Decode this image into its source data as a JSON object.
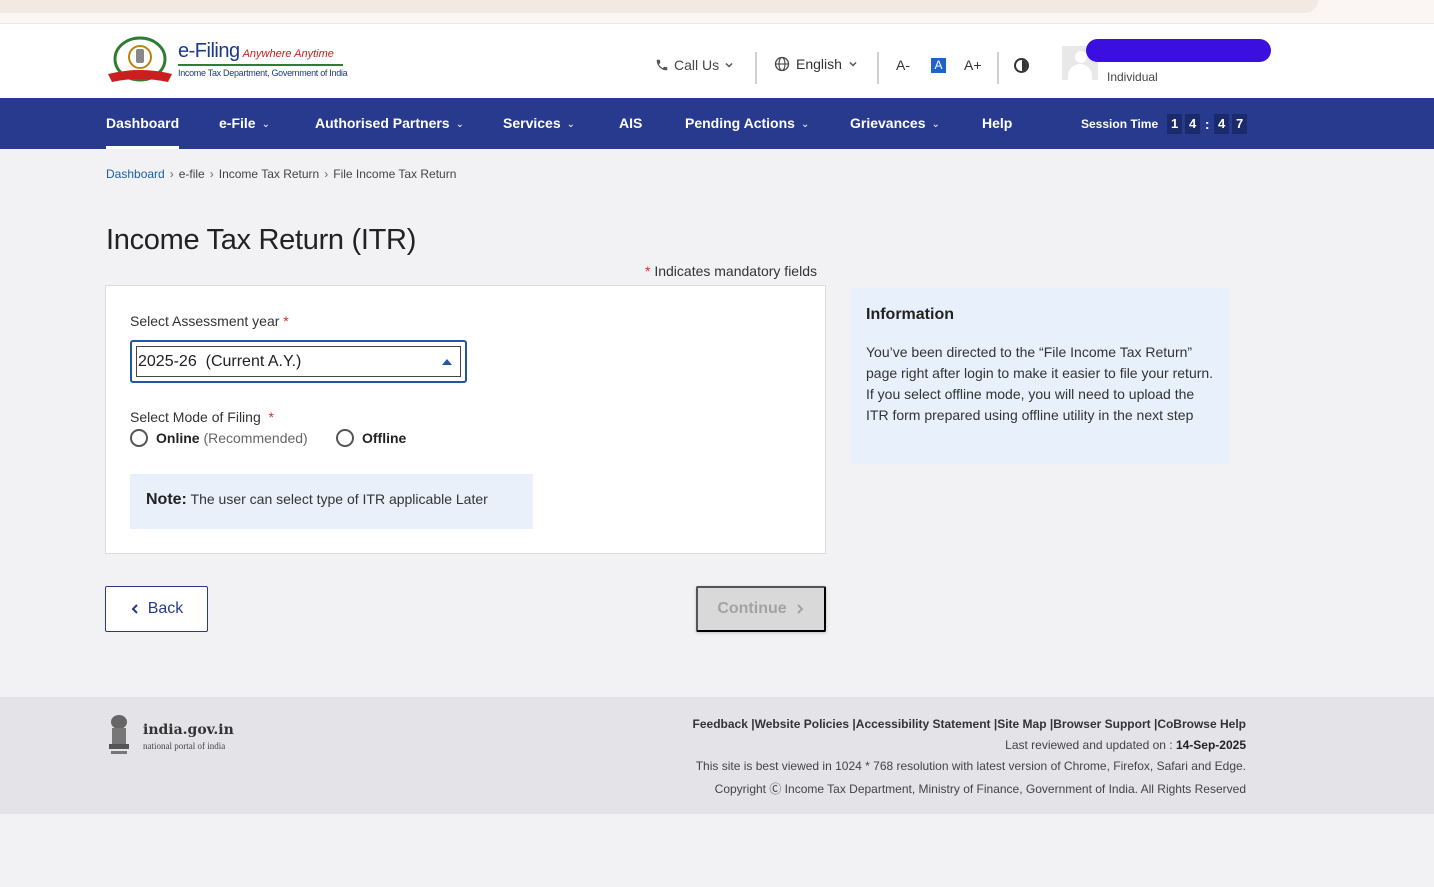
{
  "header": {
    "brand": "e-Filing",
    "tagline": "Anywhere Anytime",
    "subtitle": "Income Tax Department, Government of India",
    "call_us": "Call Us",
    "language": "English",
    "font_decrease": "A-",
    "font_normal": "A",
    "font_increase": "A+",
    "user_role": "Individual"
  },
  "nav": {
    "items": [
      {
        "label": "Dashboard"
      },
      {
        "label": "e-File"
      },
      {
        "label": "Authorised Partners"
      },
      {
        "label": "Services"
      },
      {
        "label": "AIS"
      },
      {
        "label": "Pending Actions"
      },
      {
        "label": "Grievances"
      },
      {
        "label": "Help"
      }
    ],
    "session_label": "Session Time",
    "session_digits": [
      "1",
      "4",
      ":",
      "4",
      "7"
    ]
  },
  "breadcrumb": [
    "Dashboard",
    "e-file",
    "Income Tax Return",
    "File Income Tax Return"
  ],
  "page": {
    "title": "Income Tax Return (ITR)",
    "mandatory_note": "Indicates mandatory fields",
    "star": "*"
  },
  "form": {
    "assessment_year_label": "Select Assessment year",
    "assessment_year_value": "2025-26  (Current A.Y.)",
    "mode_label": "Select Mode of Filing",
    "online_label": "Online",
    "online_hint": "(Recommended)",
    "offline_label": "Offline",
    "note_label": "Note:",
    "note_text": "The user can select type of ITR applicable Later"
  },
  "info": {
    "title": "Information",
    "text": "You’ve been directed to the “File Income Tax Return” page right after login to make it easier to file your return.\nIf you select offline mode, you will need to upload the ITR form prepared using offline utility in the next step"
  },
  "buttons": {
    "back": "Back",
    "continue": "Continue"
  },
  "footer": {
    "india_title": "india.gov.in",
    "india_sub": "national portal of india",
    "links": [
      "Feedback",
      "Website Policies",
      "Accessibility Statement",
      "Site Map",
      "Browser Support",
      "CoBrowse Help"
    ],
    "reviewed_label": "Last reviewed and updated on :",
    "reviewed_date": "14-Sep-2025",
    "resolution": "This site is best viewed in 1024 * 768 resolution with latest version of Chrome, Firefox, Safari and Edge.",
    "copyright": "Copyright Ⓒ Income Tax Department, Ministry of Finance, Government of India. All Rights Reserved"
  },
  "colors": {
    "nav_bg": "#273a8e",
    "link_blue": "#1a5ea8",
    "required_red": "#d32f2f",
    "info_bg": "#e8f1fb"
  }
}
